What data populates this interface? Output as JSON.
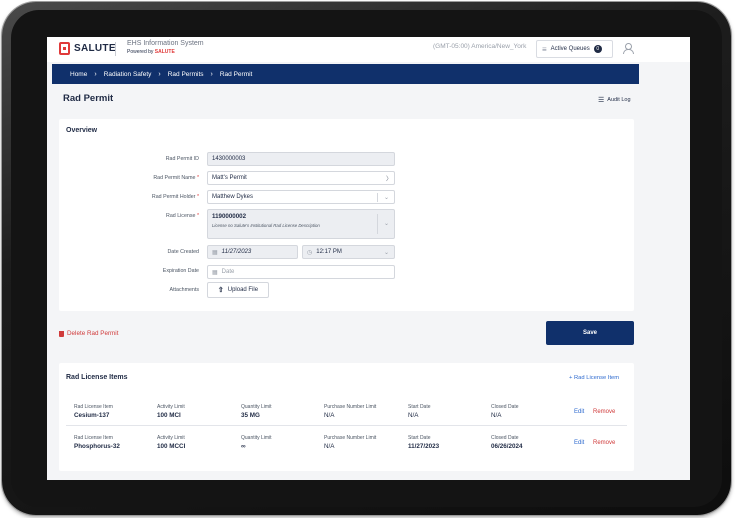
{
  "header": {
    "logo_text": "SALUTE",
    "system_title": "EHS Information System",
    "powered_by": "Powered by",
    "powered_brand": "SALUTE",
    "timezone": "(GMT-05:00) America/New_York",
    "active_queues_label": "Active Queues",
    "active_queues_count": "0"
  },
  "breadcrumb": [
    "Home",
    "Radiation Safety",
    "Rad Permits",
    "Rad Permit"
  ],
  "page": {
    "title": "Rad Permit",
    "audit_log": "Audit Log"
  },
  "overview": {
    "title": "Overview",
    "fields": {
      "permit_id": {
        "label": "Rad Permit ID",
        "value": "1430000003"
      },
      "permit_name": {
        "label": "Rad Permit Name",
        "value": "Matt's Permit"
      },
      "permit_holder": {
        "label": "Rad Permit Holder",
        "value": "Matthew Dykes"
      },
      "license": {
        "label": "Rad License",
        "value": "1190000002",
        "description": "License no Salute's Institutional Rad License Description"
      },
      "date_created": {
        "label": "Date Created",
        "date": "11/27/2023",
        "time": "12:17 PM"
      },
      "expiration_date": {
        "label": "Expiration Date",
        "placeholder": "Date"
      },
      "attachments": {
        "label": "Attachments",
        "button": "Upload File"
      }
    },
    "required_mark": "*"
  },
  "actions": {
    "delete_label": "Delete Rad Permit",
    "save_label": "Save"
  },
  "license_items": {
    "title": "Rad License Items",
    "add_label": "+ Rad License Item",
    "columns": [
      "Rad License Item",
      "Activity Limit",
      "Quantity Limit",
      "Purchase Number Limit",
      "Start Date",
      "Closed Date"
    ],
    "rows": [
      {
        "item": "Cesium-137",
        "activity": "100 MCI",
        "quantity": "35 MG",
        "purchase": "N/A",
        "start": "N/A",
        "closed": "N/A"
      },
      {
        "item": "Phosphorus-32",
        "activity": "100 MCCI",
        "quantity": "∞",
        "purchase": "N/A",
        "start": "11/27/2023",
        "closed": "06/26/2024"
      }
    ],
    "edit_label": "Edit",
    "remove_label": "Remove"
  }
}
